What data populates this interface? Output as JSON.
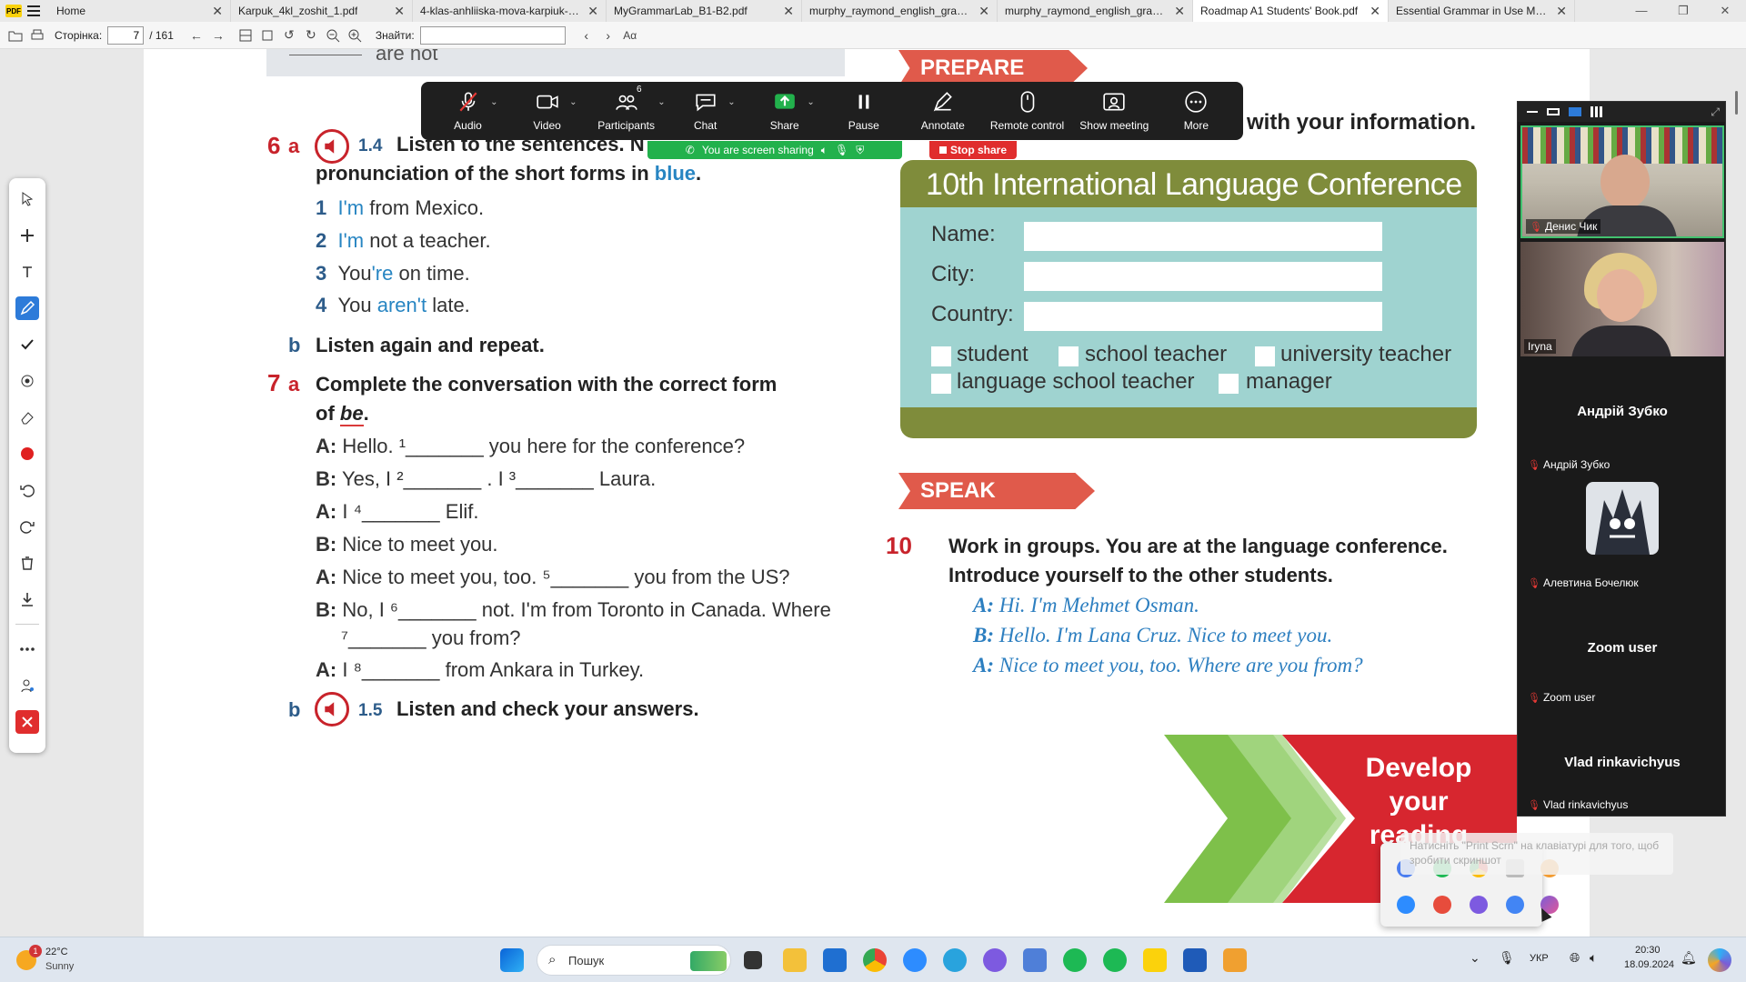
{
  "tabs": [
    {
      "label": "Home",
      "active": false
    },
    {
      "label": "Karpuk_4kl_zoshit_1.pdf",
      "active": false
    },
    {
      "label": "4-klas-anhliiska-mova-karpiuk-2...",
      "active": false
    },
    {
      "label": "MyGrammarLab_B1-B2.pdf",
      "active": false
    },
    {
      "label": "murphy_raymond_english_gram...",
      "active": false
    },
    {
      "label": "murphy_raymond_english_gram...",
      "active": false
    },
    {
      "label": "Roadmap A1 Students' Book.pdf",
      "active": true
    },
    {
      "label": "Essential Grammar in Use Murph...",
      "active": false
    }
  ],
  "toolbar": {
    "page_label": "Сторінка:",
    "page_value": "7",
    "page_total": "/ 161",
    "find_label": "Знайти:"
  },
  "zoom": {
    "buttons": [
      {
        "label": "Audio",
        "icon": "mic-muted-icon"
      },
      {
        "label": "Video",
        "icon": "video-camera-icon"
      },
      {
        "label": "Participants",
        "icon": "participants-icon",
        "count": "6"
      },
      {
        "label": "Chat",
        "icon": "chat-icon"
      },
      {
        "label": "Share",
        "icon": "share-screen-icon"
      },
      {
        "label": "Pause",
        "icon": "pause-icon"
      },
      {
        "label": "Annotate",
        "icon": "pen-icon"
      },
      {
        "label": "Remote control",
        "icon": "mouse-icon"
      },
      {
        "label": "Show meeting",
        "icon": "show-meeting-icon"
      },
      {
        "label": "More",
        "icon": "more-icon"
      }
    ],
    "sharing_text": "You are screen sharing",
    "stop_share": "Stop share",
    "share_color": "#22b14c",
    "stop_color": "#e02d2d"
  },
  "book": {
    "prepare_label": "PREPARE",
    "top_fragment": "are not",
    "header_right": "with your information.",
    "ex6": {
      "num": "6",
      "a": "a",
      "audio": "1.4",
      "line1": "Listen to the sentences. N",
      "line2_start": "pronunciation of the short forms in ",
      "line2_blue": "blue",
      "line2_end": ".",
      "items": [
        {
          "n": "1",
          "blue": "I'm",
          "rest": " from Mexico."
        },
        {
          "n": "2",
          "blue": "I'm",
          "rest": " not a teacher."
        },
        {
          "n": "3",
          "pre": "You",
          "blue": "'re",
          "rest": " on time."
        },
        {
          "n": "4",
          "pre": "You ",
          "blue": "aren't",
          "rest": " late."
        }
      ],
      "b": "b",
      "b_text": "Listen again and repeat."
    },
    "ex7": {
      "num": "7",
      "a": "a",
      "line1": "Complete the conversation with the correct form",
      "line2_start": "of ",
      "line2_be": "be",
      "line2_end": ".",
      "lines": [
        {
          "sp": "A:",
          "text": "Hello. ¹_______ you here for the conference?"
        },
        {
          "sp": "B:",
          "text": "Yes, I ²_______ . I ³_______ Laura."
        },
        {
          "sp": "A:",
          "text": "I ⁴_______ Elif."
        },
        {
          "sp": "B:",
          "text": "Nice to meet you."
        },
        {
          "sp": "A:",
          "text": "Nice to meet you, too. ⁵_______ you from the US?"
        },
        {
          "sp": "B:",
          "text": "No, I ⁶_______ not. I'm from Toronto in Canada. Where"
        },
        {
          "sp": "",
          "text": "⁷_______ you from?"
        },
        {
          "sp": "A:",
          "text": "I ⁸_______ from Ankara in Turkey."
        }
      ],
      "b": "b",
      "audio": "1.5",
      "b_text": "Listen and check your answers."
    },
    "form": {
      "title": "10th International Language Conference",
      "name": "Name:",
      "city": "City:",
      "country": "Country:",
      "options": [
        "student",
        "school teacher",
        "university teacher",
        "language school teacher",
        "manager"
      ]
    },
    "speak_label": "SPEAK",
    "ex10": {
      "num": "10",
      "line1": "Work in groups. You are at the language conference.",
      "line2": "Introduce yourself to the other students.",
      "dialog": [
        {
          "sp": "A:",
          "text": "Hi. I'm Mehmet Osman."
        },
        {
          "sp": "B:",
          "text": "Hello. I'm Lana Cruz. Nice to meet you."
        },
        {
          "sp": "A:",
          "text": "Nice to meet you, too. Where are you from?"
        }
      ]
    },
    "develop": [
      "Develop",
      "your",
      "reading"
    ]
  },
  "participants": [
    {
      "name": "Денис Чик",
      "type": "video"
    },
    {
      "name": "Iryna",
      "type": "video"
    },
    {
      "name": "Андрій Зубко",
      "big": "Андрій Зубко",
      "type": "name"
    },
    {
      "name": "Алевтина Бочелюк",
      "type": "avatar"
    },
    {
      "name": "Zoom user",
      "big": "Zoom user",
      "type": "name"
    },
    {
      "name": "Vlad rinkavichyus",
      "big": "Vlad rinkavichyus",
      "type": "name"
    }
  ],
  "tooltip": "Натисніть \"Print Scrn\" на клавіатурі для того, щоб зробити скриншот",
  "taskbar": {
    "weather_temp": "22°C",
    "weather_desc": "Sunny",
    "weather_badge": "1",
    "search": "Пошук",
    "lang": "УКР",
    "time": "20:30",
    "date": "18.09.2024"
  }
}
